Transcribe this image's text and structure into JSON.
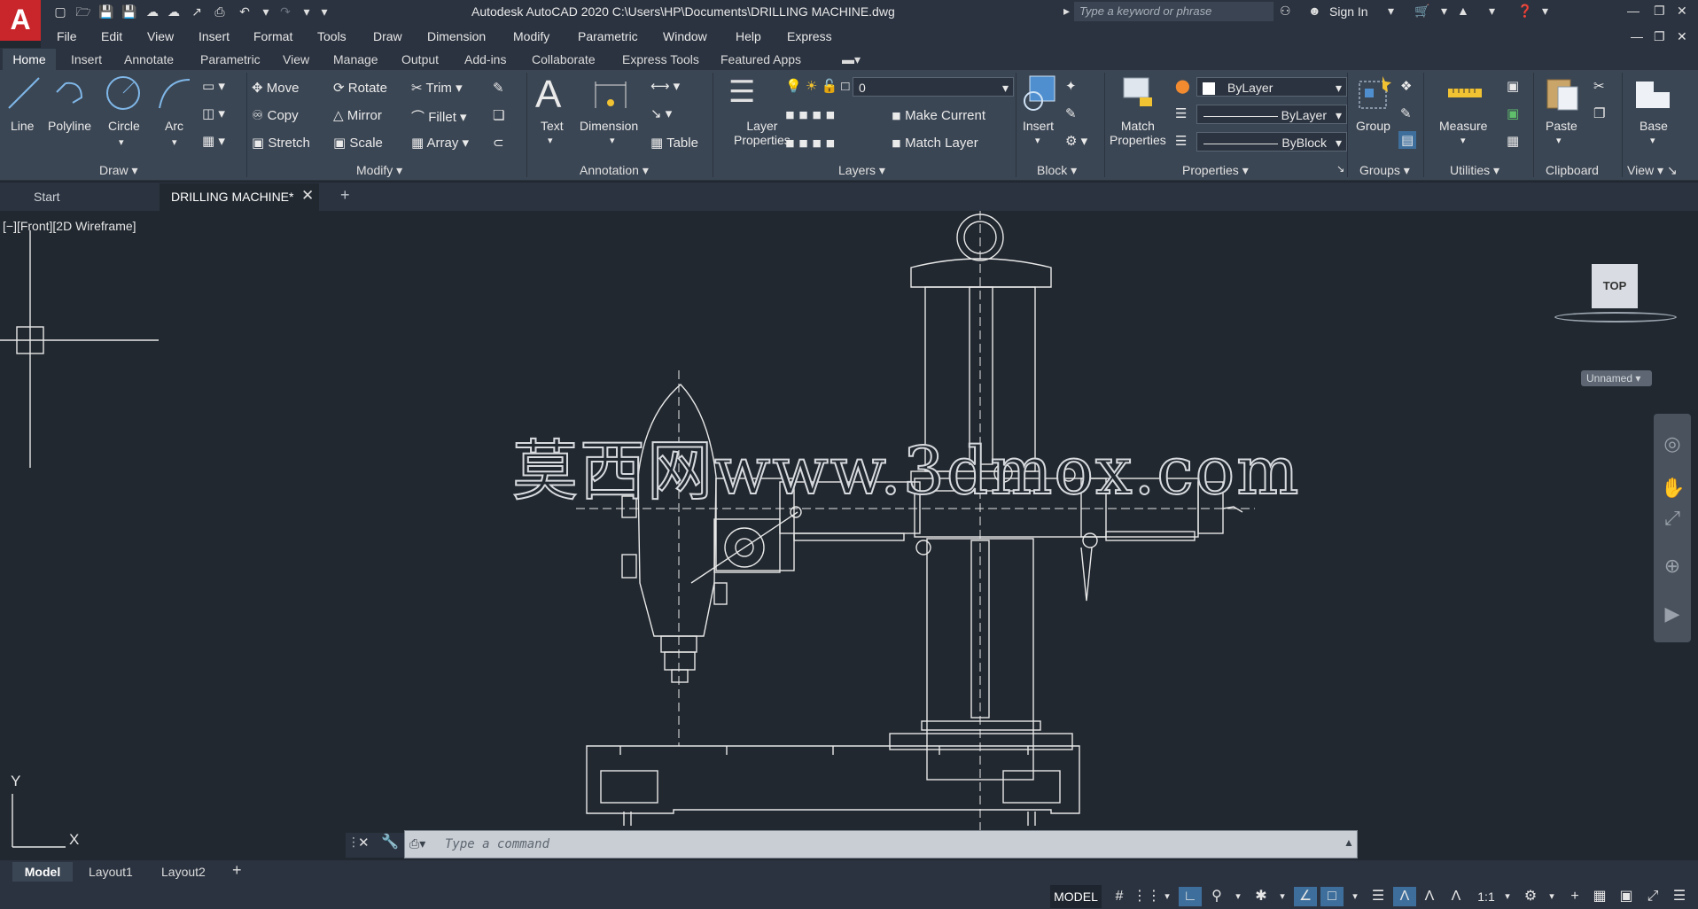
{
  "app": {
    "logo_letter": "A",
    "title": "Autodesk AutoCAD 2020    C:\\Users\\HP\\Documents\\DRILLING MACHINE.dwg",
    "search_placeholder": "Type a keyword or phrase",
    "sign_in": "Sign In",
    "accent": "#c8262b"
  },
  "menu": [
    "File",
    "Edit",
    "View",
    "Insert",
    "Format",
    "Tools",
    "Draw",
    "Dimension",
    "Modify",
    "Parametric",
    "Window",
    "Help",
    "Express"
  ],
  "ribbon_tabs": [
    "Home",
    "Insert",
    "Annotate",
    "Parametric",
    "View",
    "Manage",
    "Output",
    "Add-ins",
    "Collaborate",
    "Express Tools",
    "Featured Apps"
  ],
  "draw": {
    "title": "Draw",
    "line": "Line",
    "polyline": "Polyline",
    "circle": "Circle",
    "arc": "Arc"
  },
  "modify": {
    "title": "Modify",
    "move": "Move",
    "rotate": "Rotate",
    "trim": "Trim",
    "copy": "Copy",
    "mirror": "Mirror",
    "fillet": "Fillet",
    "stretch": "Stretch",
    "scale": "Scale",
    "array": "Array"
  },
  "annotation": {
    "title": "Annotation",
    "text": "Text",
    "dimension": "Dimension",
    "table": "Table"
  },
  "layers": {
    "title": "Layers",
    "layer_properties_1": "Layer",
    "layer_properties_2": "Properties",
    "current_layer": "0",
    "make_current": "Make Current",
    "match_layer": "Match Layer"
  },
  "block": {
    "title": "Block",
    "insert": "Insert"
  },
  "properties": {
    "title": "Properties",
    "match_1": "Match",
    "match_2": "Properties",
    "color": "ByLayer",
    "linetype": "ByLayer",
    "lineweight": "ByBlock"
  },
  "groups": {
    "title": "Groups",
    "group": "Group"
  },
  "utilities": {
    "title": "Utilities",
    "measure": "Measure"
  },
  "clipboard": {
    "title": "Clipboard",
    "paste": "Paste"
  },
  "view_panel": {
    "title": "View",
    "base": "Base"
  },
  "file_tabs": {
    "start": "Start",
    "drawing": "DRILLING MACHINE*"
  },
  "viewport": {
    "label": "[−][Front][2D Wireframe]",
    "navcube": "TOP",
    "ucs_name": "Unnamed",
    "axis_y": "Y",
    "axis_x": "X",
    "watermark": "莫西网www.3dmox.com"
  },
  "command": {
    "placeholder": "Type a command"
  },
  "layout_tabs": [
    "Model",
    "Layout1",
    "Layout2"
  ],
  "status": {
    "model": "MODEL",
    "scale": "1:1"
  }
}
